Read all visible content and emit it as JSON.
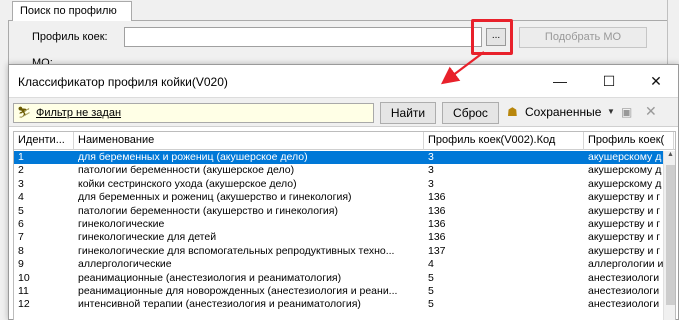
{
  "form": {
    "tab_label": "Поиск по профилю",
    "profile_label": "Профиль коек:",
    "profile_value": "",
    "dots_label": "...",
    "match_button": "Подобрать МО",
    "mo_label": "МО:"
  },
  "dialog": {
    "title": "Классификатор профиля койки(V020)",
    "min_glyph": "—",
    "max_glyph": "☐",
    "close_glyph": "✕",
    "toolbar": {
      "filter_icon": "⛷",
      "filter_text": "Фильтр не задан",
      "find_button": "Найти",
      "reset_button": "Сброс",
      "saved_icon": "☗",
      "saved_label": "Сохраненные",
      "saved_caret": "▼",
      "disk_icon": "▣",
      "x_icon": "✕"
    },
    "grid": {
      "columns": [
        "Иденти...",
        "Наименование",
        "Профиль коек(V002).Код",
        "Профиль коек("
      ],
      "rows": [
        [
          "1",
          "для беременных и рожениц (акушерское дело)",
          "3",
          "акушерскому д"
        ],
        [
          "2",
          "патологии беременности (акушерское дело)",
          "3",
          "акушерскому д"
        ],
        [
          "3",
          "койки сестринского ухода (акушерское дело)",
          "3",
          "акушерскому д"
        ],
        [
          "4",
          "для беременных и рожениц (акушерство и гинекология)",
          "136",
          "акушерству и г"
        ],
        [
          "5",
          "патологии беременности (акушерство и гинекология)",
          "136",
          "акушерству и г"
        ],
        [
          "6",
          "гинекологические",
          "136",
          "акушерству и г"
        ],
        [
          "7",
          "гинекологические для детей",
          "136",
          "акушерству и г"
        ],
        [
          "8",
          "гинекологические для вспомогательных репродуктивных техно...",
          "137",
          "акушерству и г"
        ],
        [
          "9",
          "аллергологические",
          "4",
          "аллергологии и"
        ],
        [
          "10",
          "реанимационные (анестезиология и реаниматология)",
          "5",
          "анестезиологи"
        ],
        [
          "11",
          "реанимационные для новорожденных (анестезиология и реани...",
          "5",
          "анестезиологи"
        ],
        [
          "12",
          "интенсивной терапии (анестезиология и реаниматология)",
          "5",
          "анестезиологи"
        ]
      ],
      "selected_index": 0
    }
  },
  "colors": {
    "highlight": "#e8212b",
    "selection": "#0078d7",
    "filter_bg": "#ffffe6"
  }
}
